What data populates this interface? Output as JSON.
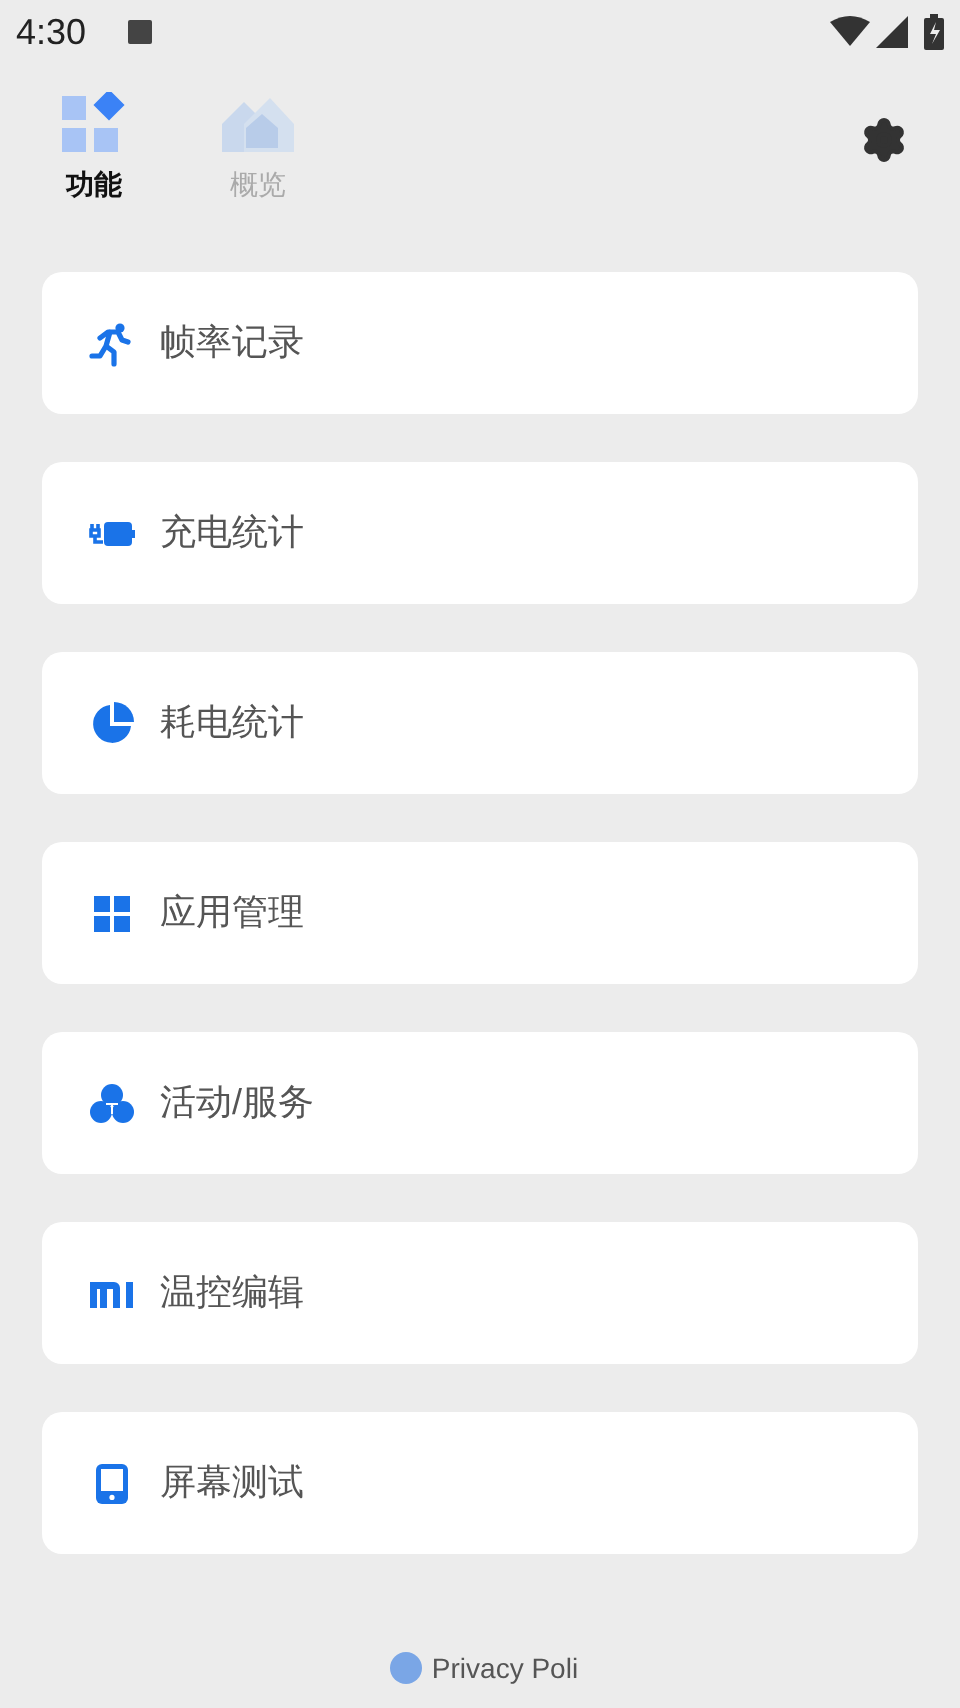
{
  "status_bar": {
    "time": "4:30"
  },
  "tabs": [
    {
      "label": "功能",
      "selected": true
    },
    {
      "label": "概览",
      "selected": false
    }
  ],
  "items": [
    {
      "kind": "run",
      "label": "帧率记录"
    },
    {
      "kind": "charge",
      "label": "充电统计"
    },
    {
      "kind": "pie",
      "label": "耗电统计"
    },
    {
      "kind": "grid",
      "label": "应用管理"
    },
    {
      "kind": "circles",
      "label": "活动/服务"
    },
    {
      "kind": "mi",
      "label": "温控编辑"
    },
    {
      "kind": "tablet",
      "label": "屏幕测试"
    }
  ],
  "footer": {
    "link": "Privacy Poli"
  }
}
